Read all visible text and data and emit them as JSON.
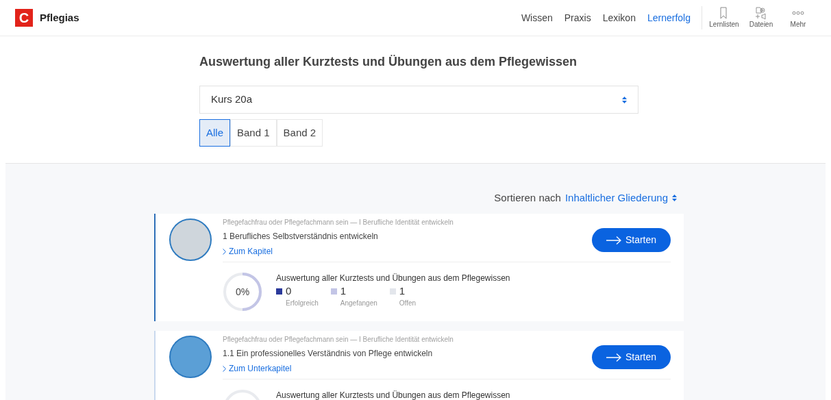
{
  "brand": {
    "name": "Pflegias",
    "logo_letter": "C"
  },
  "nav": [
    {
      "label": "Wissen",
      "selected": false
    },
    {
      "label": "Praxis",
      "selected": false
    },
    {
      "label": "Lexikon",
      "selected": false
    },
    {
      "label": "Lernerfolg",
      "selected": true
    }
  ],
  "tools": [
    {
      "label": "Lernlisten",
      "kind": "bookmark"
    },
    {
      "label": "Dateien",
      "kind": "files"
    },
    {
      "label": "Mehr",
      "kind": "more"
    }
  ],
  "title": "Auswertung aller Kurztests und Übungen aus dem Pflegewissen",
  "course_select": {
    "value": "Kurs 20a"
  },
  "tabs": [
    {
      "label": "Alle",
      "selected": true
    },
    {
      "label": "Band 1",
      "selected": false
    },
    {
      "label": "Band 2",
      "selected": false
    }
  ],
  "sort": {
    "label": "Sortieren nach",
    "value": "Inhaltlicher Gliederung"
  },
  "cards": [
    {
      "kind": "photo",
      "selected": true,
      "path": "Pflegefachfrau oder Pflegefachmann sein — I Berufliche Identität entwickeln",
      "title": "1 Berufliches Selbstverständnis entwickeln",
      "link": "Zum Kapitel",
      "button": "Starten",
      "progress": {
        "heading": "Auswertung aller Kurztests und Übungen aus dem Pflegewissen",
        "percent": "0%",
        "level": 0.5,
        "stats": [
          {
            "value": "0",
            "label": "Erfolgreich",
            "color": "#2b3a9b"
          },
          {
            "value": "1",
            "label": "Angefangen",
            "color": "#c3c5e6"
          },
          {
            "value": "1",
            "label": "Offen",
            "color": "#e3e6ec"
          }
        ]
      }
    },
    {
      "kind": "plain",
      "selected": false,
      "path": "Pflegefachfrau oder Pflegefachmann sein — I Berufliche Identität entwickeln",
      "title": "1.1 Ein professionelles Verständnis von Pflege entwickeln",
      "link": "Zum Unterkapitel",
      "button": "Starten",
      "progress": {
        "heading": "Auswertung aller Kurztests und Übungen aus dem Pflegewissen"
      }
    }
  ]
}
